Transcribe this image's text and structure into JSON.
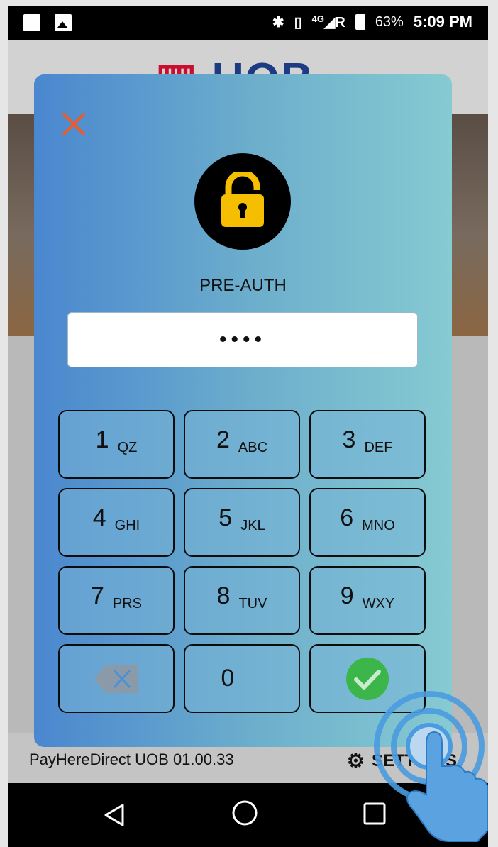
{
  "status_bar": {
    "battery": "63%",
    "time": "5:09 PM",
    "network": "4G"
  },
  "app": {
    "logo": "UOB",
    "version": "PayHereDirect UOB 01.00.33",
    "settings_label": "SETTINGS"
  },
  "dialog": {
    "title": "PRE-AUTH",
    "pin_masked": "••••",
    "keys": [
      {
        "num": "1",
        "letters": "QZ"
      },
      {
        "num": "2",
        "letters": "ABC"
      },
      {
        "num": "3",
        "letters": "DEF"
      },
      {
        "num": "4",
        "letters": "GHI"
      },
      {
        "num": "5",
        "letters": "JKL"
      },
      {
        "num": "6",
        "letters": "MNO"
      },
      {
        "num": "7",
        "letters": "PRS"
      },
      {
        "num": "8",
        "letters": "TUV"
      },
      {
        "num": "9",
        "letters": "WXY"
      },
      {
        "num": "0",
        "letters": ""
      }
    ]
  },
  "colors": {
    "close": "#f05a28",
    "lock": "#f6be00",
    "confirm": "#3cb54a",
    "backspace": "#8b9aa8"
  },
  "icons": {
    "close": "close-icon",
    "lock": "lock-icon",
    "backspace": "backspace-icon",
    "confirm": "check-circle-icon",
    "settings": "gear-icon"
  }
}
